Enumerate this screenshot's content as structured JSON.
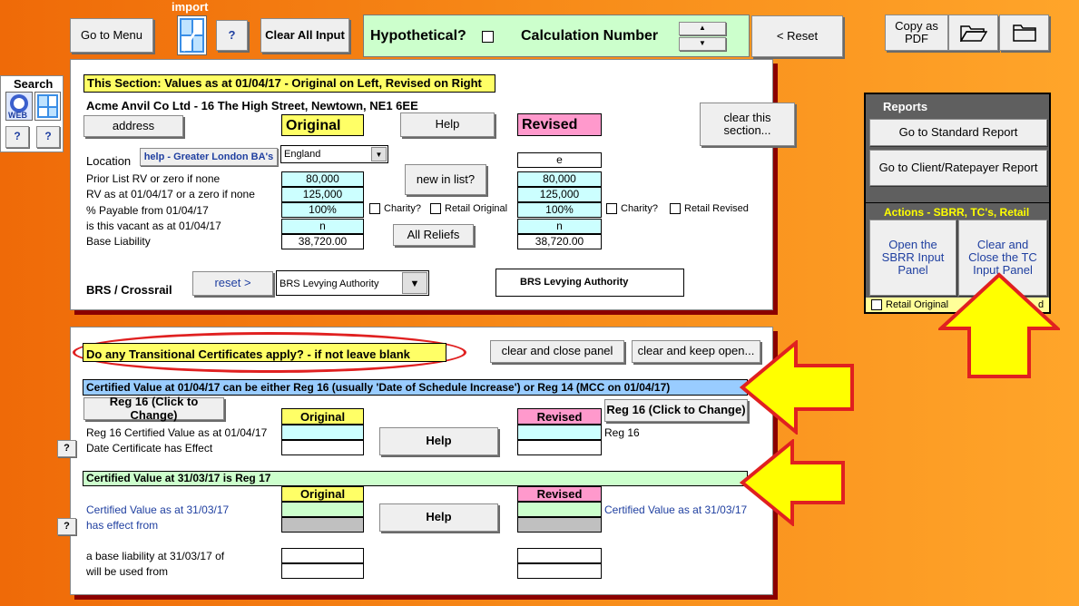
{
  "toolbar": {
    "go_to_menu": "Go to Menu",
    "import_label": "import",
    "help_q": "?",
    "clear_all": "Clear All Input",
    "hypothetical": "Hypothetical?",
    "calc_number": "Calculation Number",
    "reset": "< Reset",
    "copy_pdf": "Copy as PDF"
  },
  "search": {
    "title": "Search",
    "q1": "?",
    "q2": "?"
  },
  "section1": {
    "header": "This Section: Values as at 01/04/17 - Original on Left, Revised on Right",
    "address_line": "Acme Anvil Co Ltd - 16 The High Street, Newtown, NE1 6EE",
    "address_btn": "address",
    "original": "Original",
    "revised": "Revised",
    "help": "Help",
    "clear_section": "clear this section...",
    "location_label": "Location",
    "help_ba": "help - Greater London BA's",
    "location_value": "England",
    "revised_location": "e",
    "prior_rv_label": "Prior List RV or zero if none",
    "rv_label": "RV as at 01/04/17 or a zero if none",
    "payable_label": "% Payable from 01/04/17",
    "vacant_label": "is this vacant as at 01/04/17",
    "base_label": "Base Liability",
    "orig_prior": "80,000",
    "orig_rv": "125,000",
    "orig_payable": "100%",
    "orig_vacant": "n",
    "orig_base": "38,720.00",
    "rev_prior": "80,000",
    "rev_rv": "125,000",
    "rev_payable": "100%",
    "rev_vacant": "n",
    "rev_base": "38,720.00",
    "new_in_list": "new in list?",
    "all_reliefs": "All Reliefs",
    "charity": "Charity?",
    "retail_original": "Retail Original",
    "retail_revised": "Retail Revised",
    "brs_label": "BRS / Crossrail",
    "reset_btn": "reset >",
    "brs_select": "BRS Levying Authority",
    "brs_box": "BRS Levying Authority"
  },
  "reports": {
    "title": "Reports",
    "standard": "Go to Standard Report",
    "client": "Go to Client/Ratepayer Report",
    "actions_title": "Actions - SBRR, TC's, Retail",
    "sbrr": "Open the SBRR Input Panel",
    "tc": "Clear and Close the TC Input Panel",
    "retail_original": "Retail Original",
    "retail_rev_partial": "d"
  },
  "section2": {
    "question": "Do any Transitional Certificates apply? - if not leave blank",
    "clear_close": "clear and close panel",
    "clear_keep": "clear and keep open...",
    "cv_header": "Certified Value at 01/04/17 can be either Reg 16 (usually 'Date of Schedule Increase') or Reg 14 (MCC on 01/04/17)",
    "reg16_btn": "Reg 16 (Click to Change)",
    "original": "Original",
    "revised": "Revised",
    "reg16_btn_rev": "Reg 16 (Click to Change)",
    "reg16_cv_label": "Reg 16 Certified Value as at 01/04/17",
    "date_effect_label": "Date Certificate has Effect",
    "help": "Help",
    "reg16_text": "Reg 16",
    "q": "?",
    "cv17_header": "Certified Value at 31/03/17 is Reg 17",
    "cv17_label1": "Certified Value as at 31/03/17",
    "cv17_label2": "has effect from",
    "cv17_rev_label": "Certified Value as at 31/03/17",
    "base_label1": "a base liability at 31/03/17 of",
    "base_label2": "will be used from"
  },
  "colors": {
    "yellow": "#ffff66",
    "pink": "#ff99cc",
    "cyan": "#ccffff",
    "green": "#ccffcc",
    "arrow": "#ffff00",
    "arrow_border": "#e02020"
  }
}
